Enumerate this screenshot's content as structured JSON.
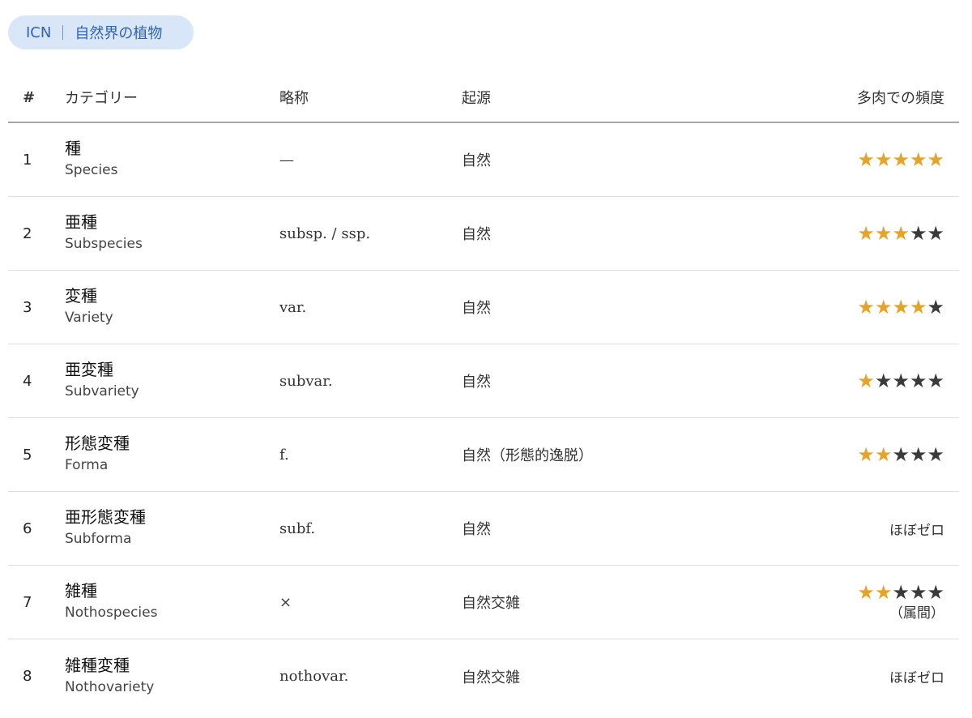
{
  "badge": {
    "left": "ICN",
    "right": "自然界の植物"
  },
  "colors": {
    "badge_bg": "#d8e6f8",
    "badge_text": "#2f62b8",
    "star_on": "#e5a32a",
    "star_off": "#3a3a3a"
  },
  "icons": {
    "star": "star-icon"
  },
  "table": {
    "headers": {
      "num": "#",
      "category": "カテゴリー",
      "abbr": "略称",
      "origin": "起源",
      "frequency": "多肉での頻度"
    },
    "rows": [
      {
        "num": "1",
        "ja": "種",
        "en": "Species",
        "abbr": "—",
        "origin": "自然",
        "stars": 5,
        "freq_text": "",
        "freq_note": ""
      },
      {
        "num": "2",
        "ja": "亜種",
        "en": "Subspecies",
        "abbr": "subsp. / ssp.",
        "origin": "自然",
        "stars": 3,
        "freq_text": "",
        "freq_note": ""
      },
      {
        "num": "3",
        "ja": "変種",
        "en": "Variety",
        "abbr": "var.",
        "origin": "自然",
        "stars": 4,
        "freq_text": "",
        "freq_note": ""
      },
      {
        "num": "4",
        "ja": "亜変種",
        "en": "Subvariety",
        "abbr": "subvar.",
        "origin": "自然",
        "stars": 1,
        "freq_text": "",
        "freq_note": ""
      },
      {
        "num": "5",
        "ja": "形態変種",
        "en": "Forma",
        "abbr": "f.",
        "origin": "自然（形態的逸脱）",
        "stars": 2,
        "freq_text": "",
        "freq_note": ""
      },
      {
        "num": "6",
        "ja": "亜形態変種",
        "en": "Subforma",
        "abbr": "subf.",
        "origin": "自然",
        "stars": null,
        "freq_text": "ほぼゼロ",
        "freq_note": ""
      },
      {
        "num": "7",
        "ja": "雑種",
        "en": "Nothospecies",
        "abbr": "×",
        "origin": "自然交雑",
        "stars": 2,
        "freq_text": "",
        "freq_note": "（属間）"
      },
      {
        "num": "8",
        "ja": "雑種変種",
        "en": "Nothovariety",
        "abbr": "nothovar.",
        "origin": "自然交雑",
        "stars": null,
        "freq_text": "ほぼゼロ",
        "freq_note": ""
      }
    ]
  }
}
